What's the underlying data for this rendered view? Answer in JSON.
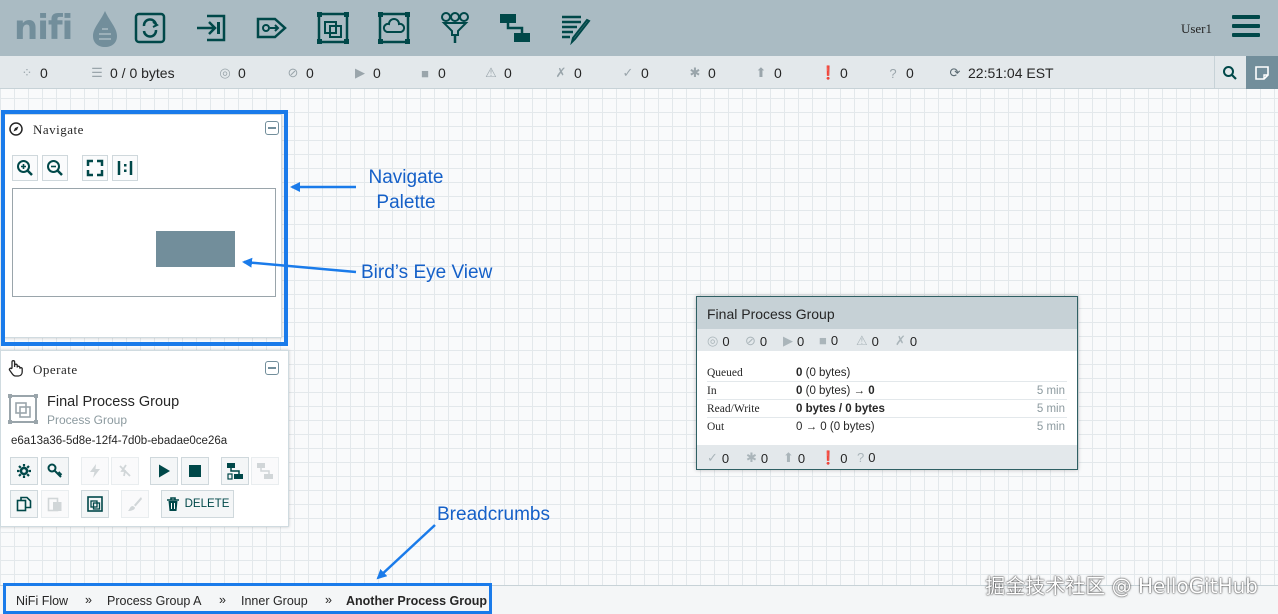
{
  "header": {
    "logo": "nifi",
    "user": "User1",
    "toolbar_icons": [
      "processor-icon",
      "input-port-icon",
      "output-port-icon",
      "process-group-icon",
      "remote-process-group-icon",
      "funnel-icon",
      "template-icon",
      "label-icon"
    ]
  },
  "status": {
    "active_threads": "0",
    "queued": "0 / 0 bytes",
    "transmitting": "0",
    "not_transmitting": "0",
    "running": "0",
    "stopped": "0",
    "invalid": "0",
    "disabled": "0",
    "up_to_date": "0",
    "locally_modified": "0",
    "stale": "0",
    "sync_failure": "0",
    "unknown": "0",
    "last_refreshed": "22:51:04 EST"
  },
  "navigate": {
    "title": "Navigate"
  },
  "operate": {
    "title": "Operate",
    "component_name": "Final Process Group",
    "component_type": "Process Group",
    "component_id": "e6a13a36-5d8e-12f4-7d0b-ebadae0ce26a",
    "delete_label": "DELETE"
  },
  "annotations": {
    "navigate_line1": "Navigate",
    "navigate_line2": "Palette",
    "birds_eye": "Bird’s Eye View",
    "breadcrumbs": "Breadcrumbs"
  },
  "process_group": {
    "name": "Final Process Group",
    "transmitting": "0",
    "not_transmitting": "0",
    "running": "0",
    "stopped": "0",
    "invalid": "0",
    "disabled": "0",
    "queued_label": "Queued",
    "queued_value": "0",
    "queued_bytes": "(0 bytes)",
    "in_label": "In",
    "in_value": "0",
    "in_bytes": "(0 bytes) → ",
    "in_out": "0",
    "in_time": "5 min",
    "rw_label": "Read/Write",
    "rw_value": "0 bytes / 0 bytes",
    "rw_time": "5 min",
    "out_label": "Out",
    "out_value": "0 → 0",
    "out_bytes": "(0 bytes)",
    "out_time": "5 min",
    "up_to_date": "0",
    "locally_modified": "0",
    "stale": "0",
    "sync_failure": "0",
    "unknown": "0"
  },
  "breadcrumbs": {
    "items": [
      "NiFi Flow",
      "Process Group A",
      "Inner Group",
      "Another Process Group"
    ],
    "separator": "»"
  },
  "watermark": "掘金技术社区 @ HelloGitHub",
  "colors": {
    "header": "#aabbc3",
    "accent": "#004849",
    "highlight": "#1a7bea",
    "annotation": "#1560c8"
  }
}
